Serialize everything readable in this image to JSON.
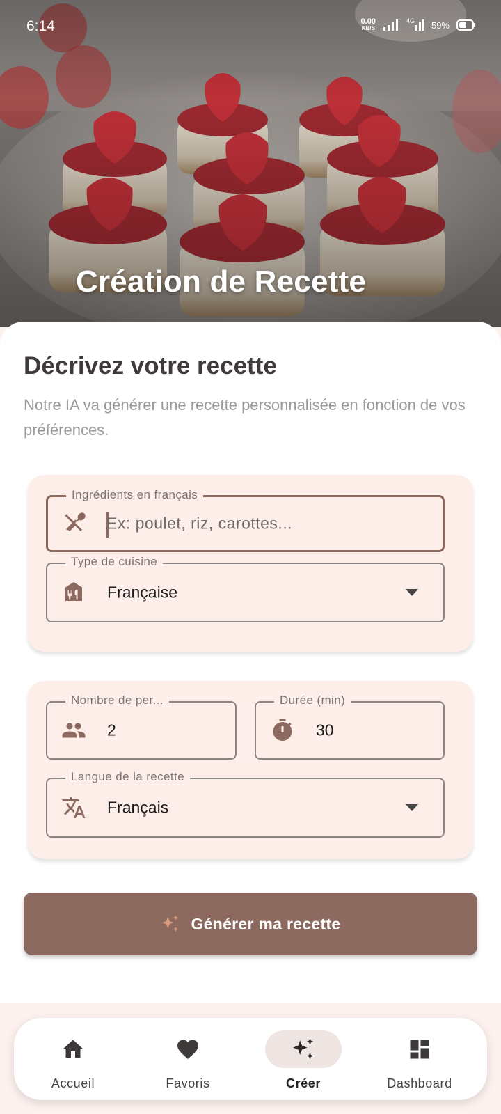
{
  "status_bar": {
    "time": "6:14",
    "net_speed_value": "0.00",
    "net_speed_unit": "KB/S",
    "network_type": "4G",
    "battery": "59%"
  },
  "hero": {
    "title": "Création de Recette",
    "image": "strawberry-cheesecake-photo"
  },
  "intro": {
    "title": "Décrivez votre recette",
    "description": "Notre IA va générer une recette personnalisée en fonction de vos préférences."
  },
  "form": {
    "ingredients": {
      "label": "Ingrédients en français",
      "placeholder": "Ex: poulet, riz, carottes...",
      "value": "",
      "icon": "utensils-icon"
    },
    "cuisine": {
      "label": "Type de cuisine",
      "value": "Française",
      "icon": "restaurant-icon"
    },
    "people": {
      "label": "Nombre de per...",
      "value": "2",
      "icon": "people-icon"
    },
    "duration": {
      "label": "Durée (min)",
      "value": "30",
      "icon": "timer-icon"
    },
    "language": {
      "label": "Langue de la recette",
      "value": "Français",
      "icon": "translate-icon"
    }
  },
  "generate_button": {
    "label": "Générer ma recette",
    "icon": "sparkle-icon"
  },
  "bottom_nav": {
    "items": [
      {
        "label": "Accueil",
        "icon": "home-icon",
        "active": false
      },
      {
        "label": "Favoris",
        "icon": "heart-icon",
        "active": false
      },
      {
        "label": "Créer",
        "icon": "sparkle-icon",
        "active": true
      },
      {
        "label": "Dashboard",
        "icon": "dashboard-icon",
        "active": false
      }
    ]
  },
  "colors": {
    "primary": "#8d6a5f",
    "card_background": "#fdeeea",
    "active_nav_pill": "#eee4e1"
  }
}
